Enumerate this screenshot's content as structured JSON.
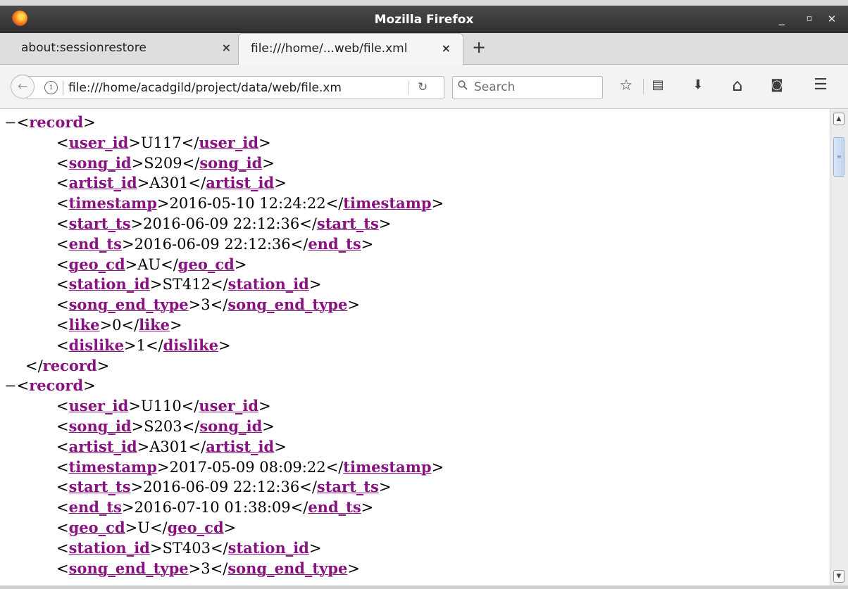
{
  "window": {
    "title": "Mozilla Firefox",
    "minimize": "_",
    "maximize": "▫",
    "close": "✕"
  },
  "tabs": [
    {
      "label": "about:sessionrestore",
      "close": "×"
    },
    {
      "label": "file:///home/...web/file.xml",
      "close": "×"
    }
  ],
  "new_tab": "+",
  "nav": {
    "back": "←",
    "info": "i",
    "url": "file:///home/acadgild/project/data/web/file.xm",
    "reload": "↻",
    "search_placeholder": "Search"
  },
  "toolbar": {
    "bookmark": "☆",
    "reader": "▤",
    "download": "⬇",
    "home": "⌂",
    "pocket": "◙",
    "menu": "☰"
  },
  "xml": {
    "toggle": "−",
    "record_tag": "record",
    "records": [
      {
        "fields": [
          {
            "tag": "user_id",
            "value": "U117"
          },
          {
            "tag": "song_id",
            "value": "S209"
          },
          {
            "tag": "artist_id",
            "value": "A301"
          },
          {
            "tag": "timestamp",
            "value": "2016-05-10 12:24:22"
          },
          {
            "tag": "start_ts",
            "value": "2016-06-09 22:12:36"
          },
          {
            "tag": "end_ts",
            "value": "2016-06-09 22:12:36"
          },
          {
            "tag": "geo_cd",
            "value": "AU"
          },
          {
            "tag": "station_id",
            "value": "ST412"
          },
          {
            "tag": "song_end_type",
            "value": "3"
          },
          {
            "tag": "like",
            "value": "0"
          },
          {
            "tag": "dislike",
            "value": "1"
          }
        ]
      },
      {
        "fields": [
          {
            "tag": "user_id",
            "value": "U110"
          },
          {
            "tag": "song_id",
            "value": "S203"
          },
          {
            "tag": "artist_id",
            "value": "A301"
          },
          {
            "tag": "timestamp",
            "value": "2017-05-09 08:09:22"
          },
          {
            "tag": "start_ts",
            "value": "2016-06-09 22:12:36"
          },
          {
            "tag": "end_ts",
            "value": "2016-07-10 01:38:09"
          },
          {
            "tag": "geo_cd",
            "value": "U"
          },
          {
            "tag": "station_id",
            "value": "ST403"
          },
          {
            "tag": "song_end_type",
            "value": "3"
          }
        ]
      }
    ]
  },
  "colors": {
    "tag": "#881280",
    "titlebar": "#3a3a3a"
  }
}
